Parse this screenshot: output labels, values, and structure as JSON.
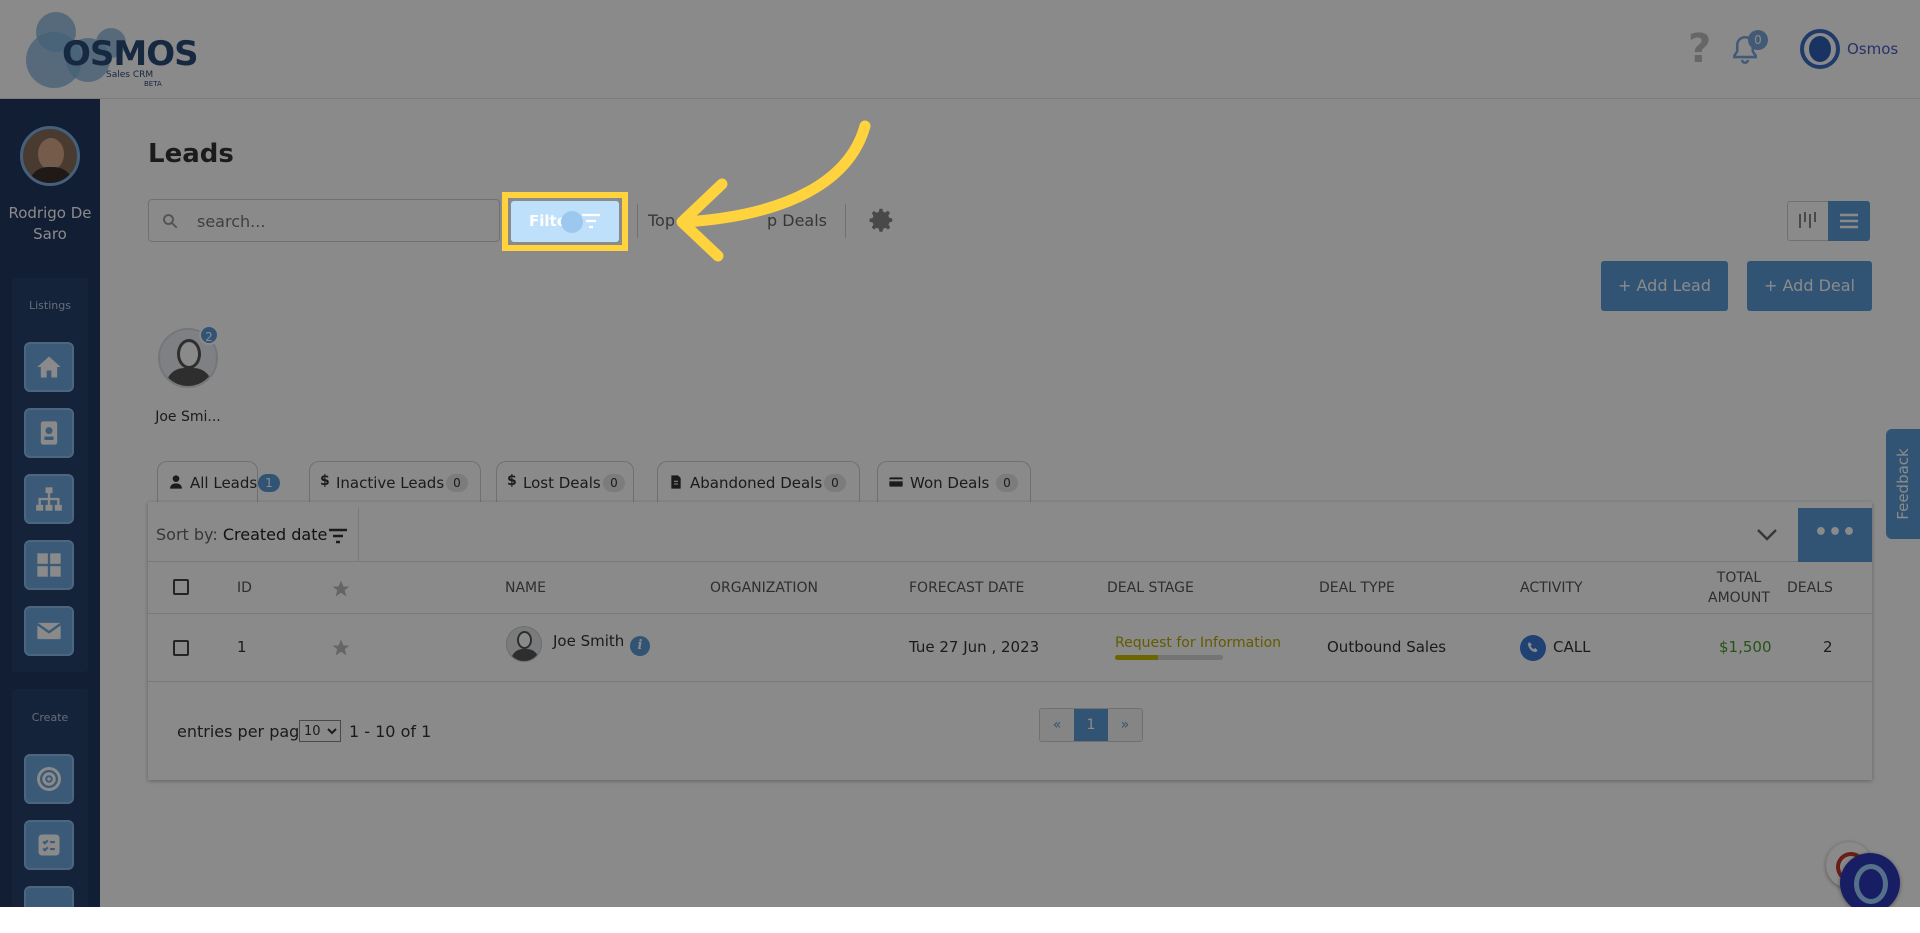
{
  "header": {
    "logo_text": "OSMOS",
    "logo_sub": "Sales CRM",
    "logo_beta": "BETA",
    "help_glyph": "?",
    "notifications_count": "0",
    "account_name": "Osmos"
  },
  "sidebar": {
    "user_name": "Rodrigo De Saro",
    "listings_label": "Listings",
    "create_label": "Create",
    "listings_icons": [
      "home-icon",
      "contact-card-icon",
      "org-chart-icon",
      "dashboard-icon",
      "mail-icon"
    ],
    "create_icons": [
      "target-icon",
      "task-list-icon"
    ]
  },
  "main": {
    "title": "Leads",
    "search_placeholder": "search...",
    "filter_label": "Filter",
    "top_deals_prefix": "Top",
    "top_deals_suffix": "p Deals",
    "add_lead": "+ Add Lead",
    "add_deal": "+ Add Deal"
  },
  "owners": [
    {
      "name": "Joe Smi...",
      "badge": "2"
    }
  ],
  "tabs": [
    {
      "label": "All Leads",
      "count": "1",
      "icon": "user-icon",
      "active": true
    },
    {
      "label": "Inactive Leads",
      "count": "0",
      "icon": "dollar-icon",
      "active": false
    },
    {
      "label": "Lost Deals",
      "count": "0",
      "icon": "dollar-icon",
      "active": false
    },
    {
      "label": "Abandoned Deals",
      "count": "0",
      "icon": "document-icon",
      "active": false
    },
    {
      "label": "Won Deals",
      "count": "0",
      "icon": "credit-card-icon",
      "active": false
    }
  ],
  "sort": {
    "prefix": "Sort by:",
    "value": "Created date",
    "more": "•••"
  },
  "table": {
    "headers": {
      "id": "ID",
      "name": "NAME",
      "organization": "ORGANIZATION",
      "forecast_date": "FORECAST DATE",
      "deal_stage": "DEAL STAGE",
      "deal_type": "DEAL TYPE",
      "activity": "ACTIVITY",
      "total_amount_1": "TOTAL",
      "total_amount_2": "AMOUNT",
      "deals": "DEALS"
    },
    "rows": [
      {
        "id": "1",
        "name": "Joe Smith",
        "info": "i",
        "organization": "",
        "forecast_date": "Tue 27 Jun , 2023",
        "deal_stage": "Request for Information",
        "deal_stage_progress": 0.4,
        "deal_type": "Outbound Sales",
        "activity": "CALL",
        "total_amount": "$1,500",
        "deals": "2"
      }
    ]
  },
  "footer": {
    "entries_label": "entries per page",
    "per_page": "10",
    "range": "1 - 10 of 1",
    "prev": "«",
    "page": "1",
    "next": "»"
  },
  "feedback_label": "Feedback",
  "colors": {
    "primary": "#5b9bd8",
    "sidebar": "#21385e",
    "highlight": "#ffd33d",
    "amount": "#4a9a2a",
    "stage": "#b8a800"
  }
}
